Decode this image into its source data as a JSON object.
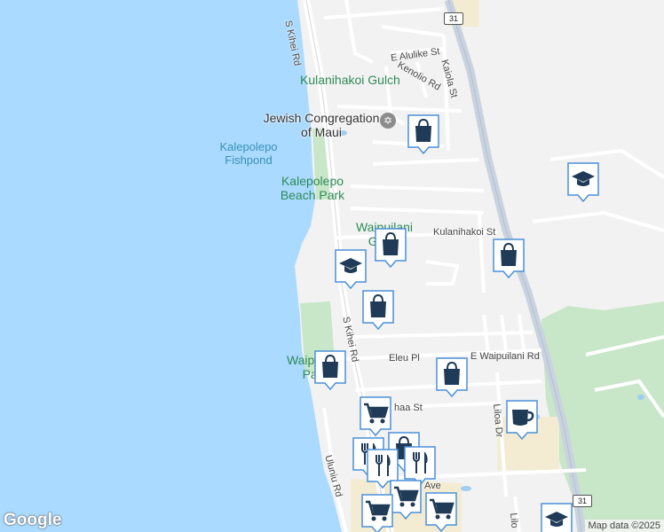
{
  "map": {
    "labels": {
      "kulanihakoi_gulch": "Kulanihakoi Gulch",
      "jewish_congregation": "Jewish Congregation of Maui",
      "kalepolepo_fishpond": "Kalepolepo Fishpond",
      "kalepolepo_beach_park": "Kalepolepo Beach Park",
      "waipuilani_gulch": "Waipuilani Gulch",
      "waipuilani_park": "Waipuilani Park"
    },
    "streets": {
      "s_kihei_rd_top": "S Kihei Rd",
      "s_kihei_rd_mid": "S Kihei Rd",
      "e_alulike": "E Alulike St",
      "kenolio": "Kenolio Rd",
      "kaiola": "Kaiola St",
      "kulanihakoi": "Kulanihakoi St",
      "eleu": "Eleu Pl",
      "e_waipuilani": "E Waipuilani Rd",
      "liloa": "Liloa Dr",
      "ululu": "Uluniu Rd",
      "ohaa": "haa St",
      "ave": "Ave",
      "lilo_fragment": "Lilo"
    },
    "route_shields": [
      "31",
      "31"
    ],
    "google_logo": "Google",
    "attribution": "Map data ©2025"
  },
  "markers": [
    {
      "type": "shopping",
      "icon": "shopping-bag-icon"
    },
    {
      "type": "shopping",
      "icon": "shopping-bag-icon"
    },
    {
      "type": "school",
      "icon": "graduation-cap-icon"
    },
    {
      "type": "shopping",
      "icon": "shopping-bag-icon"
    },
    {
      "type": "school",
      "icon": "graduation-cap-icon"
    },
    {
      "type": "shopping",
      "icon": "shopping-bag-icon"
    },
    {
      "type": "shopping",
      "icon": "shopping-bag-icon"
    },
    {
      "type": "shopping",
      "icon": "shopping-bag-icon"
    },
    {
      "type": "shopping",
      "icon": "shopping-bag-icon"
    },
    {
      "type": "grocery",
      "icon": "shopping-cart-icon"
    },
    {
      "type": "cafe",
      "icon": "coffee-cup-icon"
    },
    {
      "type": "restaurant",
      "icon": "fork-knife-icon"
    },
    {
      "type": "restaurant",
      "icon": "fork-knife-icon"
    },
    {
      "type": "restaurant",
      "icon": "fork-knife-icon"
    },
    {
      "type": "grocery",
      "icon": "shopping-cart-icon"
    },
    {
      "type": "grocery",
      "icon": "shopping-cart-icon"
    },
    {
      "type": "grocery",
      "icon": "shopping-cart-icon"
    },
    {
      "type": "school",
      "icon": "graduation-cap-icon"
    }
  ],
  "colors": {
    "ocean": "#aadaff",
    "land": "#f2f2f2",
    "park": "#c5e8c5",
    "road": "#ffffff",
    "highway": "#c9d3df",
    "marker_bg": "#ffffff",
    "marker_icon": "#1f3b57",
    "marker_border": "#4a90d9"
  }
}
